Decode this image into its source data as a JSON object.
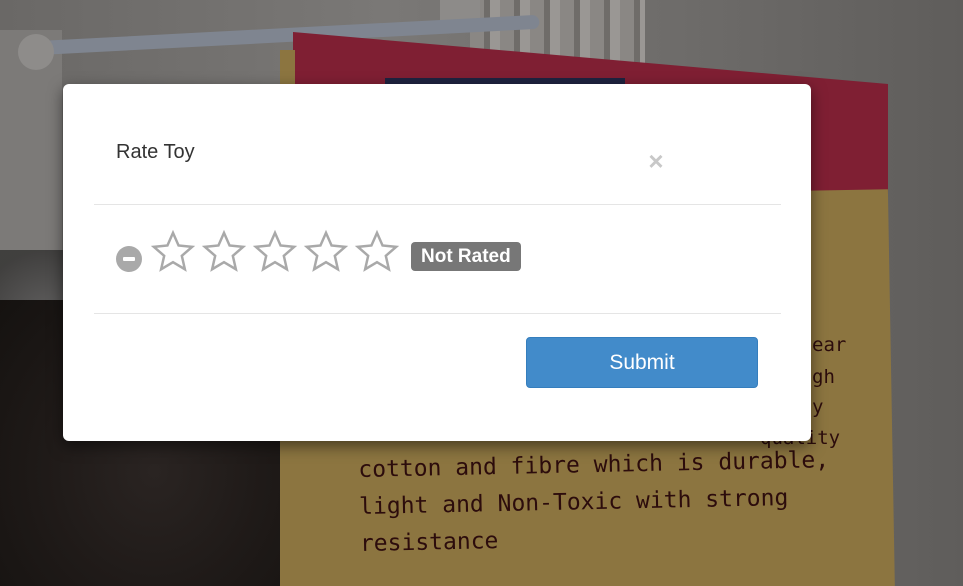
{
  "modal": {
    "title": "Rate Toy",
    "close_label": "×",
    "rating_caption": "Not Rated",
    "submit_label": "Submit",
    "stars_total": 5,
    "stars_filled": 0
  },
  "background_card": {
    "fragments": [
      "ear",
      "gh",
      "y",
      "quality"
    ],
    "text_lines": [
      "cotton and fibre which is durable,",
      "light and Non-Toxic with strong",
      "resistance"
    ]
  },
  "colors": {
    "submit": "#428bca",
    "badge": "#777777",
    "star_outline": "#a9a9a9"
  }
}
